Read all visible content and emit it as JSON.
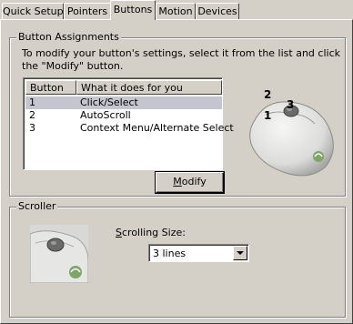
{
  "tabs": [
    {
      "label": "Quick Setup",
      "active": false
    },
    {
      "label": "Pointers",
      "active": false
    },
    {
      "label": "Buttons",
      "active": true
    },
    {
      "label": "Motion",
      "active": false
    },
    {
      "label": "Devices",
      "active": false
    }
  ],
  "buttons_group": {
    "title": "Button Assignments",
    "instructions": "To modify your button's settings, select it from the list and click the \"Modify\" button.",
    "columns": [
      "Button",
      "What it does for you"
    ],
    "rows": [
      {
        "button": "1",
        "action": "Click/Select",
        "selected": true
      },
      {
        "button": "2",
        "action": "AutoScroll",
        "selected": false
      },
      {
        "button": "3",
        "action": "Context Menu/Alternate Select",
        "selected": false
      }
    ],
    "modify_label": {
      "mnemonic": "M",
      "rest": "odify"
    },
    "mouse_button_labels": [
      "2",
      "1",
      "3"
    ]
  },
  "scroller_group": {
    "title": "Scroller",
    "scrolling_size_label": {
      "mnemonic": "S",
      "rest": "crolling Size:"
    },
    "scrolling_size_value": "3 lines"
  },
  "colors": {
    "face": "#d4d0c8",
    "selection": "#c5c5cf",
    "mouse_body": "#e4e4e2",
    "logo_green": "#7fa56a"
  }
}
